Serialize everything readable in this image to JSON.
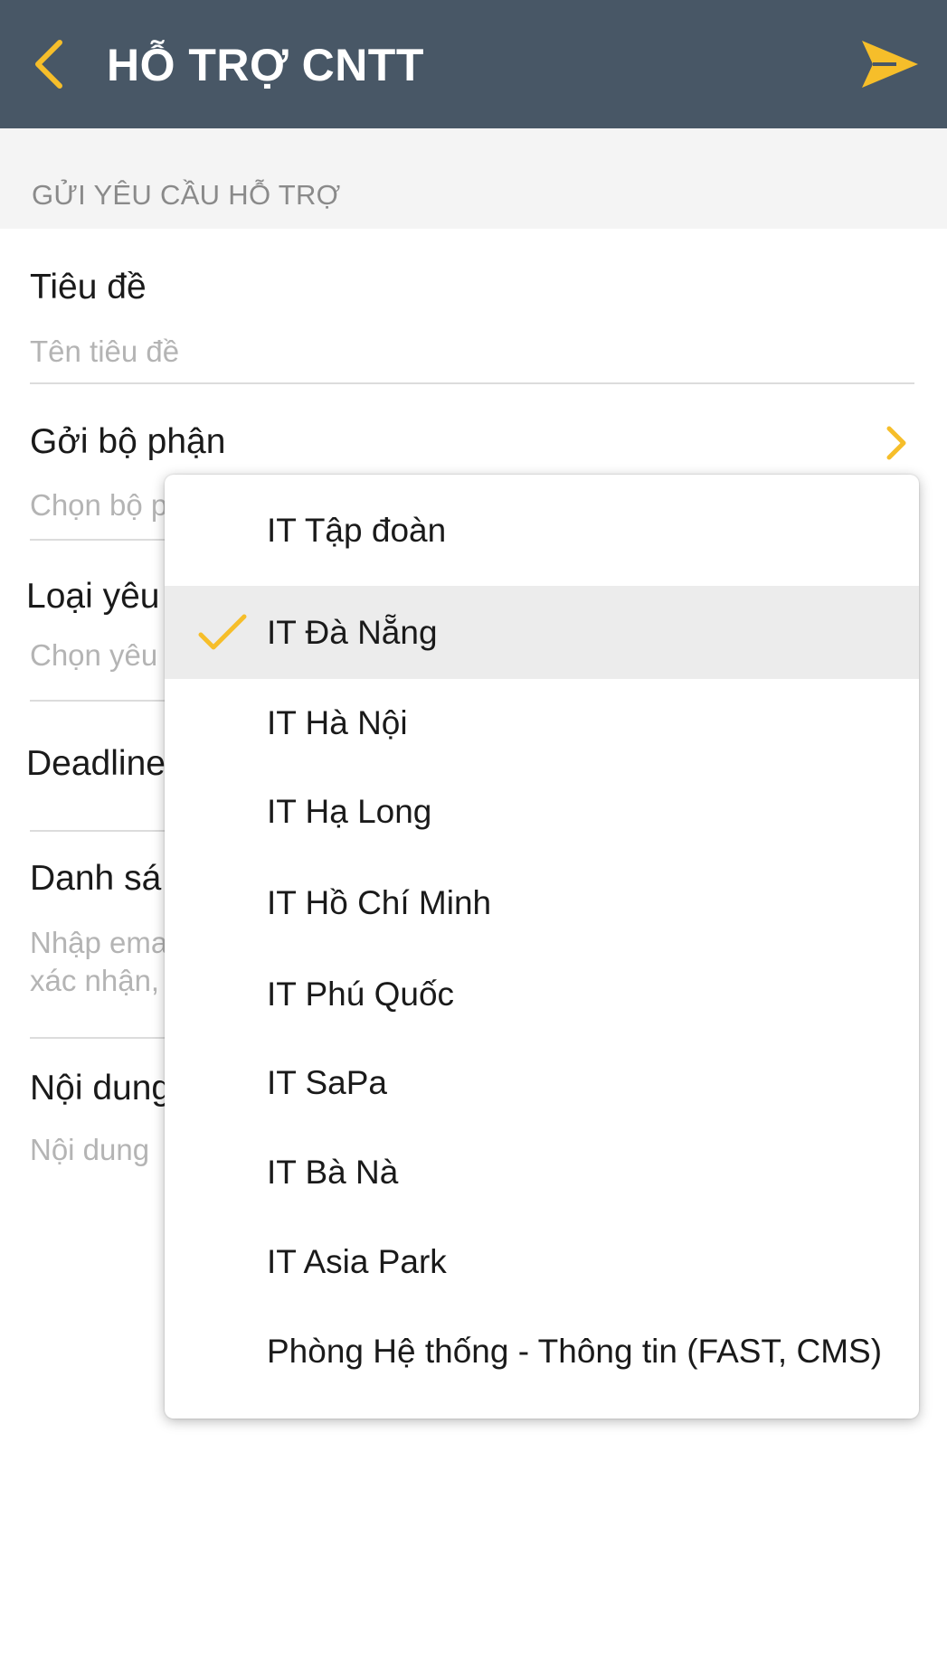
{
  "nav": {
    "title": "HỖ TRỢ CNTT",
    "back_icon": "chevron-left-icon",
    "send_icon": "send-icon",
    "accent_color": "#F6BE2A",
    "bar_color": "#485766"
  },
  "section": {
    "header": "GỬI YÊU CẦU HỖ TRỢ"
  },
  "form": {
    "title_label": "Tiêu đề",
    "title_placeholder": "Tên tiêu đề",
    "department_label": "Gởi bộ phận",
    "department_placeholder": "Chọn bộ p",
    "request_type_label": "Loại yêu",
    "request_type_placeholder": "Chọn yêu",
    "deadline_label": "Deadline",
    "list_label": "Danh sá",
    "list_placeholder_line1": "Nhập ema",
    "list_placeholder_line2": "xác nhận,",
    "content_label": "Nội dung",
    "content_placeholder": "Nội dung"
  },
  "dropdown": {
    "selected_index": 1,
    "items": [
      "IT Tập đoàn",
      "IT Đà Nẵng",
      "IT Hà Nội",
      "IT Hạ Long",
      "IT Hồ Chí Minh",
      "IT Phú Quốc",
      "IT SaPa",
      "IT Bà Nà",
      "IT Asia Park",
      "Phòng Hệ thống - Thông tin (FAST, CMS)"
    ]
  }
}
